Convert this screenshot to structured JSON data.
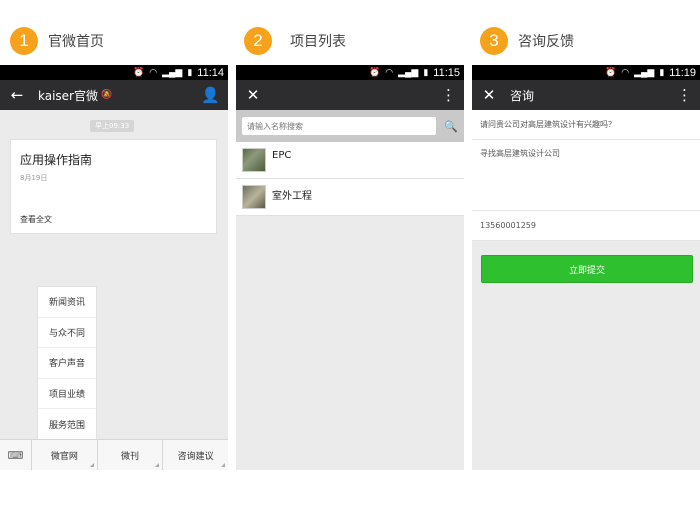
{
  "steps": [
    {
      "num": "1",
      "label": "官微首页"
    },
    {
      "num": "2",
      "label": "项目列表"
    },
    {
      "num": "3",
      "label": "咨询反馈"
    }
  ],
  "accent_color": "#f7a21c",
  "button_color": "#2fc02f",
  "phone1": {
    "clock": "11:14",
    "title": "kaiser官微",
    "timestamp": "早上09:33",
    "card": {
      "title": "应用操作指南",
      "date": "8月19日",
      "link": "查看全文"
    },
    "popup_menu": [
      "新闻资讯",
      "与众不同",
      "客户声音",
      "项目业绩",
      "服务范围"
    ],
    "bottom_menu": [
      "微官网",
      "微刊",
      "咨询建议"
    ]
  },
  "phone2": {
    "clock": "11:15",
    "search_placeholder": "请输入名称搜索",
    "items": [
      "EPC",
      "室外工程"
    ]
  },
  "phone3": {
    "clock": "11:19",
    "title": "咨询",
    "question": "请问贵公司对高层建筑设计有兴趣吗？",
    "answer": "寻找高层建筑设计公司",
    "phone": "13560001259",
    "submit_label": "立即提交"
  }
}
